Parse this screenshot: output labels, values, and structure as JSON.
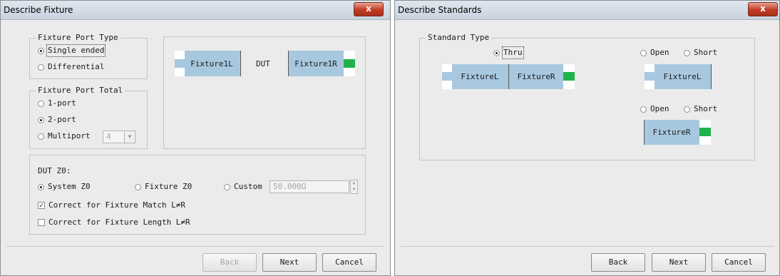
{
  "fixture": {
    "title": "Describe Fixture",
    "close_glyph": "x",
    "port_type": {
      "legend": "Fixture Port Type",
      "single_ended": "Single ended",
      "differential": "Differential"
    },
    "port_total": {
      "legend": "Fixture Port Total",
      "one_port": "1-port",
      "two_port": "2-port",
      "multiport": "Multiport",
      "multiport_value": "4"
    },
    "diagram": {
      "left": "Fixture1L",
      "dut": "DUT",
      "right": "Fixture1R"
    },
    "dut": {
      "label": "DUT Z0:",
      "system": "System Z0",
      "fixture": "Fixture Z0",
      "custom": "Custom",
      "custom_value": "50.000Ω",
      "match": "Correct for Fixture Match L≠R",
      "length": "Correct for Fixture Length L≠R"
    },
    "buttons": {
      "back": "Back",
      "next": "Next",
      "cancel": "Cancel"
    }
  },
  "standards": {
    "title": "Describe Standards",
    "close_glyph": "x",
    "legend": "Standard Type",
    "thru": "Thru",
    "thru_left": "FixtureL",
    "thru_right": "FixtureR",
    "open1": "Open",
    "short1": "Short",
    "left_box": "FixtureL",
    "open2": "Open",
    "short2": "Short",
    "right_box": "FixtureR",
    "buttons": {
      "back": "Back",
      "next": "Next",
      "cancel": "Cancel"
    }
  },
  "colors": {
    "fixture_block": "#a8c8e0",
    "port_green": "#1fb24a",
    "close_red": "#c23a22"
  }
}
